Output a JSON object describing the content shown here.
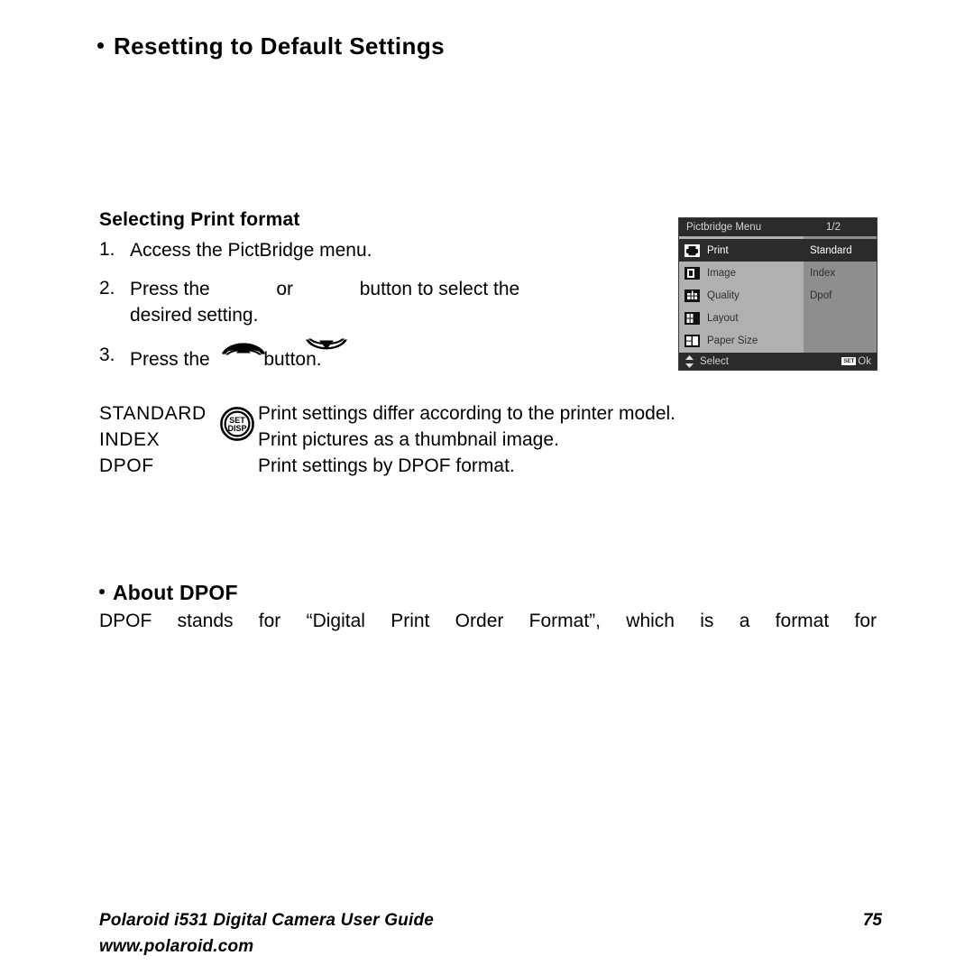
{
  "page": {
    "title": "Resetting to Default Settings",
    "section_subtitle": "Selecting Print format"
  },
  "steps": [
    {
      "num": "1.",
      "parts": [
        {
          "type": "text",
          "text": "Access the PictBridge menu."
        }
      ]
    },
    {
      "num": "2.",
      "parts": [
        {
          "type": "text",
          "text": "Press the "
        },
        {
          "type": "icon",
          "icon": "arrow-up-button"
        },
        {
          "type": "text",
          "text": " or "
        },
        {
          "type": "icon",
          "icon": "arrow-down-button"
        },
        {
          "type": "text",
          "text": " button to select the"
        }
      ],
      "second_line": "desired setting."
    },
    {
      "num": "3.",
      "parts": [
        {
          "type": "text",
          "text": "Press the "
        },
        {
          "type": "icon",
          "icon": "set-disp-button"
        },
        {
          "type": "text",
          "text": " button."
        }
      ]
    }
  ],
  "definitions": [
    {
      "term": "STANDARD",
      "desc": "Print settings differ according to the printer model."
    },
    {
      "term": "INDEX",
      "desc": "Print pictures as a thumbnail image."
    },
    {
      "term": "DPOF",
      "desc": "Print settings by DPOF format."
    }
  ],
  "about": {
    "title": "About DPOF",
    "paragraph": "DPOF stands for “Digital Print Order Format”, which is a format for"
  },
  "lcd": {
    "header_title": "Pictbridge Menu",
    "header_page": "1/2",
    "menu_items": [
      {
        "label": "Print",
        "icon": "printer-icon",
        "selected": true
      },
      {
        "label": "Image",
        "icon": "image-icon",
        "selected": false
      },
      {
        "label": "Quality",
        "icon": "quality-icon",
        "selected": false
      },
      {
        "label": "Layout",
        "icon": "layout-icon",
        "selected": false
      },
      {
        "label": "Paper Size",
        "icon": "paper-size-icon",
        "selected": false
      }
    ],
    "options": [
      {
        "label": "Standard",
        "selected": true
      },
      {
        "label": "Index",
        "selected": false
      },
      {
        "label": "Dpof",
        "selected": false
      }
    ],
    "footer_select": "Select",
    "footer_set_badge": "SET",
    "footer_ok": "Ok",
    "colors": {
      "header_bg": "#2b2b2b",
      "left_panel_bg": "#b0b0b0",
      "right_panel_bg": "#8e8e8e",
      "highlight_bg": "#2b2b2b",
      "border": "#3b3b3b"
    }
  },
  "footer": {
    "guide": "Polaroid i531 Digital Camera User Guide",
    "page_number": "75",
    "website": "www.polaroid.com"
  }
}
